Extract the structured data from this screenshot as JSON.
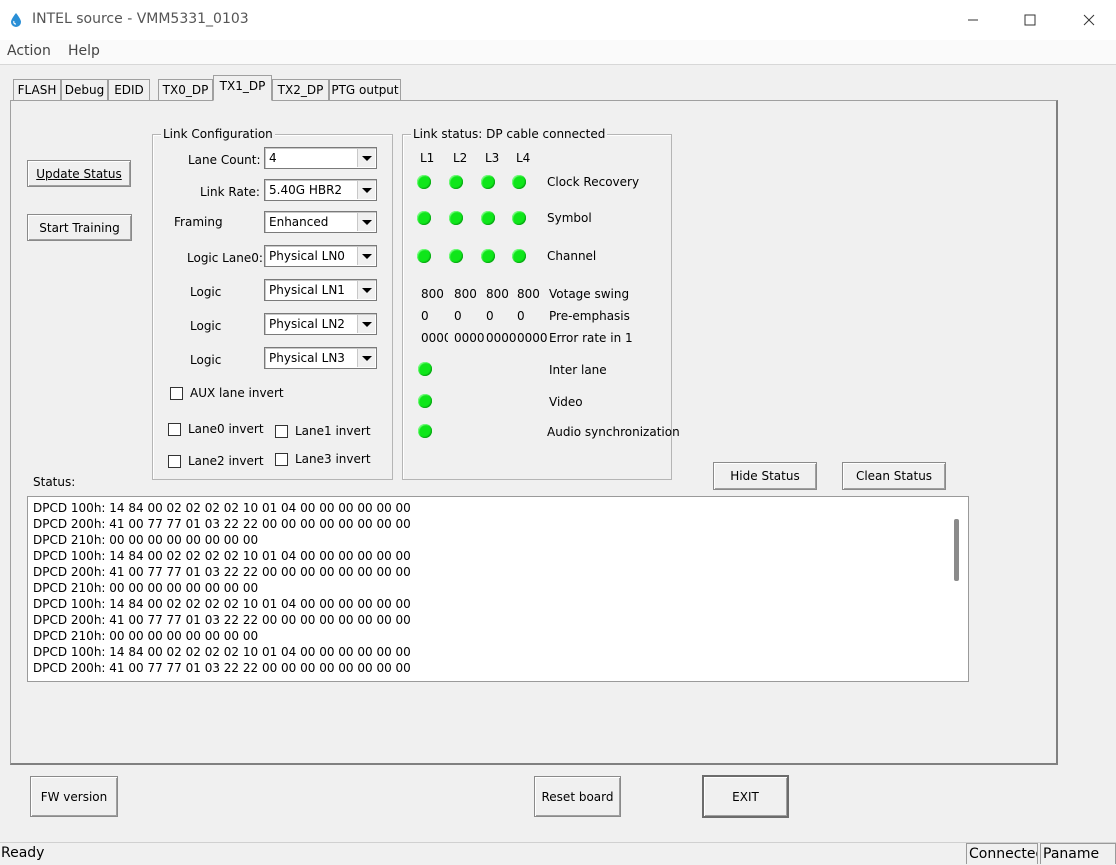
{
  "window": {
    "title": "INTEL source - VMM5331_0103",
    "app_icon": "droplet-icon",
    "controls": [
      "minimize-icon",
      "maximize-icon",
      "close-icon"
    ]
  },
  "menu": {
    "items": [
      "Action",
      "Help"
    ]
  },
  "tabs": {
    "items": [
      "FLASH",
      "Debug",
      "EDID",
      "TX0_DP",
      "TX1_DP",
      "TX2_DP",
      "PTG output"
    ],
    "active": "TX1_DP"
  },
  "buttons": {
    "update_status": "Update Status",
    "start_training": "Start Training",
    "hide_status": "Hide Status",
    "clean_status": "Clean Status",
    "fw_version": "FW version",
    "reset_board": "Reset board",
    "exit": "EXIT"
  },
  "link_config": {
    "title": "Link Configuration",
    "fields": [
      {
        "label": "Lane Count:",
        "value": "4"
      },
      {
        "label": "Link Rate:",
        "value": "5.40G HBR2"
      },
      {
        "label": "Framing",
        "value": "Enhanced"
      },
      {
        "label": "Logic Lane0:",
        "value": "Physical LN0"
      },
      {
        "label": "Logic",
        "value": "Physical LN1"
      },
      {
        "label": "Logic",
        "value": "Physical LN2"
      },
      {
        "label": "Logic",
        "value": "Physical LN3"
      }
    ],
    "aux_invert": "AUX lane invert",
    "lane_inverts": [
      "Lane0 invert",
      "Lane1 invert",
      "Lane2 invert",
      "Lane3 invert"
    ]
  },
  "link_status": {
    "title": "Link status: DP cable connected",
    "lanes": [
      "L1",
      "L2",
      "L3",
      "L4"
    ],
    "led_color": "#0fe61a",
    "rows": [
      "Clock Recovery",
      "Symbol",
      "Channel"
    ],
    "voltage_swing": {
      "label": "Votage swing",
      "values": [
        "800",
        "800",
        "800",
        "800"
      ]
    },
    "pre_emphasis": {
      "label": "Pre-emphasis",
      "values": [
        "0",
        "0",
        "0",
        "0"
      ]
    },
    "error_rate": {
      "label": "Error rate in 1",
      "values": [
        "0000",
        "0000",
        "0000",
        "0000"
      ]
    },
    "single_rows": [
      "Inter lane",
      "Video",
      "Audio synchronization"
    ]
  },
  "status": {
    "label": "Status:",
    "log": [
      "DPCD 100h: 14 84 00 02 02 02 02 10 01 04 00 00 00 00 00 00",
      "DPCD 200h: 41 00 77 77 01 03 22 22 00 00 00 00 00 00 00 00",
      "DPCD 210h: 00 00 00 00 00 00 00 00",
      "DPCD 100h: 14 84 00 02 02 02 02 10 01 04 00 00 00 00 00 00",
      "DPCD 200h: 41 00 77 77 01 03 22 22 00 00 00 00 00 00 00 00",
      "DPCD 210h: 00 00 00 00 00 00 00 00",
      "DPCD 100h: 14 84 00 02 02 02 02 10 01 04 00 00 00 00 00 00",
      "DPCD 200h: 41 00 77 77 01 03 22 22 00 00 00 00 00 00 00 00",
      "DPCD 210h: 00 00 00 00 00 00 00 00",
      "DPCD 100h: 14 84 00 02 02 02 02 10 01 04 00 00 00 00 00 00",
      "DPCD 200h: 41 00 77 77 01 03 22 22 00 00 00 00 00 00 00 00"
    ]
  },
  "statusbar": {
    "text": "Ready",
    "pane1": "Connected",
    "pane2": "Paname"
  }
}
